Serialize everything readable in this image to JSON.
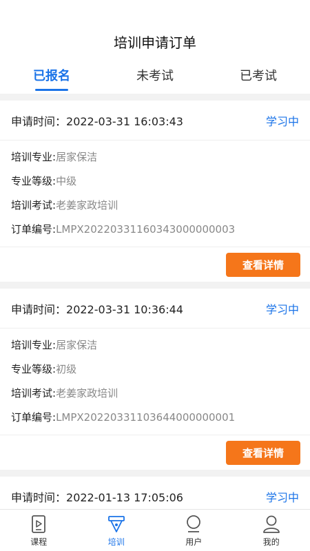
{
  "header": {
    "title": "培训申请订单",
    "tabs": [
      {
        "label": "已报名",
        "active": true
      },
      {
        "label": "未考试",
        "active": false
      },
      {
        "label": "已考试",
        "active": false
      }
    ]
  },
  "orders": [
    {
      "time_label": "申请时间：",
      "time_value": "2022-03-31 16:03:43",
      "status": "学习中",
      "fields": [
        {
          "label": "培训专业: ",
          "value": "居家保洁"
        },
        {
          "label": "专业等级: ",
          "value": "中级"
        },
        {
          "label": "培训考试: ",
          "value": "老姜家政培训"
        },
        {
          "label": "订单编号: ",
          "value": "LMPX20220331160343000000003"
        }
      ],
      "button": "查看详情"
    },
    {
      "time_label": "申请时间：",
      "time_value": "2022-03-31 10:36:44",
      "status": "学习中",
      "fields": [
        {
          "label": "培训专业: ",
          "value": "居家保洁"
        },
        {
          "label": "专业等级: ",
          "value": "初级"
        },
        {
          "label": "培训考试: ",
          "value": "老姜家政培训"
        },
        {
          "label": "订单编号: ",
          "value": "LMPX20220331103644000000001"
        }
      ],
      "button": "查看详情"
    },
    {
      "time_label": "申请时间：",
      "time_value": "2022-01-13 17:05:06",
      "status": "学习中"
    }
  ],
  "tabbar": [
    {
      "label": "课程",
      "icon": "course-icon",
      "active": false
    },
    {
      "label": "培训",
      "icon": "training-icon",
      "active": true
    },
    {
      "label": "用户",
      "icon": "user-icon",
      "active": false
    },
    {
      "label": "我的",
      "icon": "profile-icon",
      "active": false
    }
  ],
  "colors": {
    "accent": "#1a73e8",
    "button": "#f5761a"
  }
}
